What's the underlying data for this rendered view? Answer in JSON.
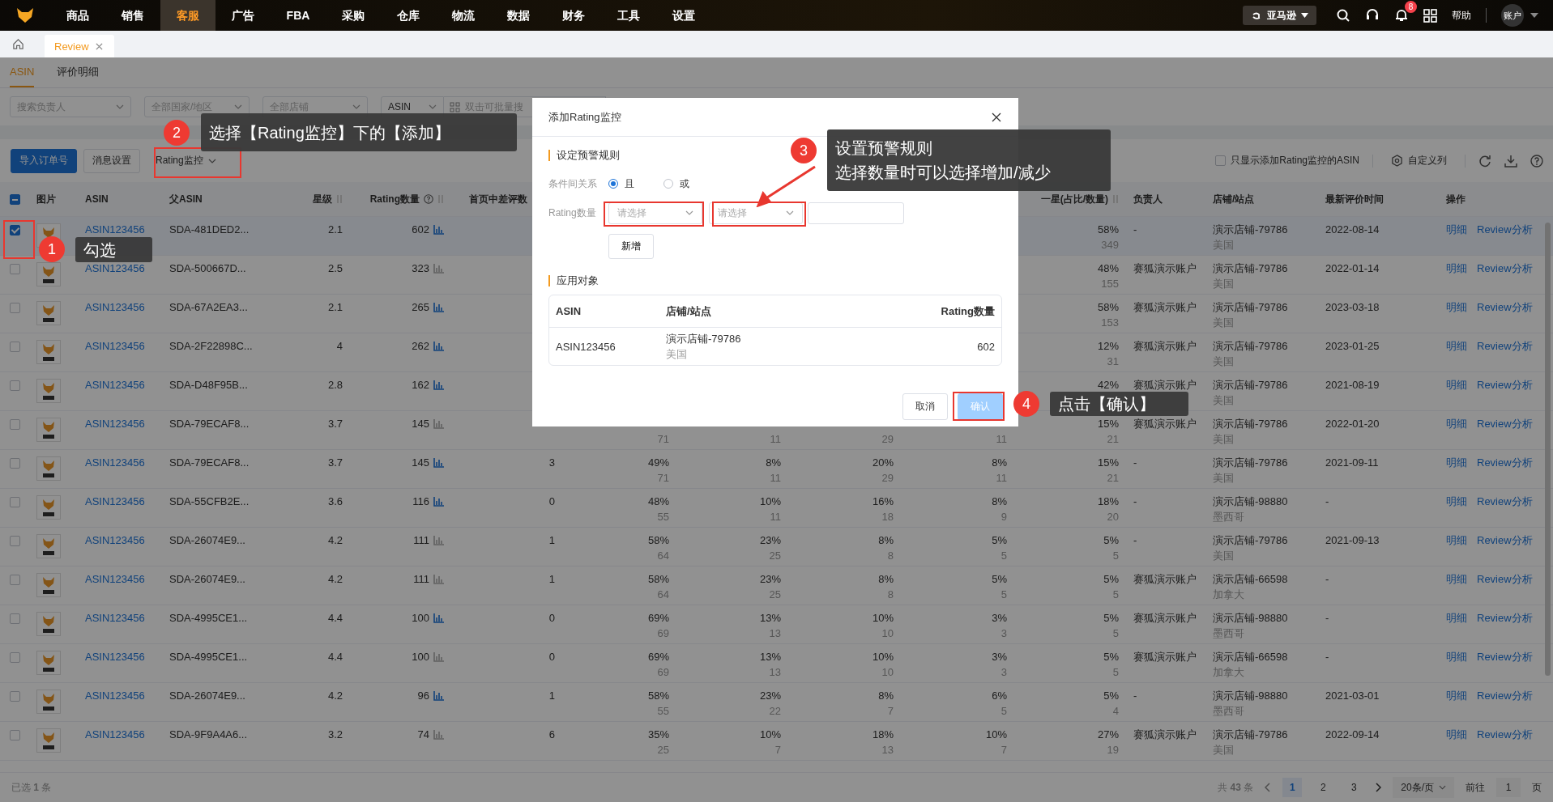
{
  "top_nav": {
    "items": [
      {
        "label": "商品",
        "selected": false
      },
      {
        "label": "销售",
        "selected": false
      },
      {
        "label": "客服",
        "selected": true
      },
      {
        "label": "广告",
        "selected": false
      },
      {
        "label": "FBA",
        "selected": false
      },
      {
        "label": "采购",
        "selected": false
      },
      {
        "label": "仓库",
        "selected": false
      },
      {
        "label": "物流",
        "selected": false
      },
      {
        "label": "数据",
        "selected": false
      },
      {
        "label": "财务",
        "selected": false
      },
      {
        "label": "工具",
        "selected": false
      },
      {
        "label": "设置",
        "selected": false
      }
    ],
    "marketplace": "亚马逊",
    "notification_count": "8",
    "help": "帮助",
    "account": "账户"
  },
  "page_tabs": [
    {
      "label": "Review",
      "selected": true
    }
  ],
  "sub_tabs": [
    {
      "label": "ASIN",
      "selected": true
    },
    {
      "label": "评价明细",
      "selected": false
    }
  ],
  "filters": [
    {
      "placeholder": "搜索负责人"
    },
    {
      "placeholder": "全部国家/地区"
    },
    {
      "placeholder": "全部店铺"
    }
  ],
  "search": {
    "field": "ASIN",
    "placeholder": "双击可批量搜"
  },
  "toolbar": {
    "buttons": [
      {
        "label": "导入订单号",
        "kind": "primary"
      },
      {
        "label": "消息设置",
        "kind": "plain"
      },
      {
        "label": "Rating监控",
        "kind": "dropdown"
      }
    ],
    "only_monitored": {
      "label": "只显示添加Rating监控的ASIN",
      "checked": false
    },
    "custom_columns": "自定义列"
  },
  "table": {
    "some_selected": true,
    "columns": [
      {
        "label": "图片",
        "sortable": false,
        "help": false
      },
      {
        "label": "ASIN",
        "sortable": false,
        "help": false
      },
      {
        "label": "父ASIN",
        "sortable": false,
        "help": false
      },
      {
        "label": "星级",
        "sortable": true,
        "help": false
      },
      {
        "label": "Rating数量",
        "sortable": true,
        "help": true
      },
      {
        "label": "首页中差评数",
        "sortable": false,
        "help": false
      },
      {
        "label": "一星(占比/数量)",
        "sortable": true,
        "help": false
      },
      {
        "label": "负责人",
        "sortable": false,
        "help": false
      },
      {
        "label": "店铺/站点",
        "sortable": false,
        "help": false
      },
      {
        "label": "最新评价时间",
        "sortable": false,
        "help": false
      },
      {
        "label": "操作",
        "sortable": false,
        "help": false
      }
    ],
    "rows": [
      {
        "selected": true,
        "asin": "ASIN123456",
        "parent_asin": "SDA-481DED2...",
        "rating": "2.1",
        "rating_count": "602",
        "trend_highlighted": true,
        "one_star": {
          "pct": "58%",
          "count": "349"
        },
        "owner": "-",
        "store": "演示店铺-79786",
        "site": "美国",
        "latest": "2022-08-14",
        "actions": [
          "明细",
          "Review分析"
        ]
      },
      {
        "selected": false,
        "asin": "ASIN123456",
        "parent_asin": "SDA-500667D...",
        "rating": "2.5",
        "rating_count": "323",
        "trend_highlighted": false,
        "one_star": {
          "pct": "48%",
          "count": "155"
        },
        "owner": "赛狐演示账户",
        "store": "演示店铺-79786",
        "site": "美国",
        "latest": "2022-01-14",
        "actions": [
          "明细",
          "Review分析"
        ]
      },
      {
        "selected": false,
        "asin": "ASIN123456",
        "parent_asin": "SDA-67A2EA3...",
        "rating": "2.1",
        "rating_count": "265",
        "trend_highlighted": true,
        "one_star": {
          "pct": "58%",
          "count": "153"
        },
        "owner": "赛狐演示账户",
        "store": "演示店铺-79786",
        "site": "美国",
        "latest": "2023-03-18",
        "actions": [
          "明细",
          "Review分析"
        ]
      },
      {
        "selected": false,
        "asin": "ASIN123456",
        "parent_asin": "SDA-2F22898C...",
        "rating": "4",
        "rating_count": "262",
        "trend_highlighted": true,
        "one_star": {
          "pct": "12%",
          "count": "31"
        },
        "owner": "赛狐演示账户",
        "store": "演示店铺-79786",
        "site": "美国",
        "latest": "2023-01-25",
        "actions": [
          "明细",
          "Review分析"
        ]
      },
      {
        "selected": false,
        "asin": "ASIN123456",
        "parent_asin": "SDA-D48F95B...",
        "rating": "2.8",
        "rating_count": "162",
        "trend_highlighted": true,
        "one_star": {
          "pct": "42%"
        },
        "owner": "赛狐演示账户",
        "store": "演示店铺-79786",
        "site": "美国",
        "latest": "2021-08-19",
        "actions": [
          "明细",
          "Review分析"
        ]
      },
      {
        "selected": false,
        "asin": "ASIN123456",
        "parent_asin": "SDA-79ECAF8...",
        "rating": "3.7",
        "rating_count": "145",
        "trend_highlighted": false,
        "dist": [
          {
            "count": "71"
          },
          {
            "count": "11"
          },
          {
            "count": "29"
          },
          {
            "count": "11"
          }
        ],
        "one_star": {
          "pct": "15%",
          "count": "21"
        },
        "owner": "赛狐演示账户",
        "store": "演示店铺-79786",
        "site": "美国",
        "latest": "2022-01-20",
        "actions": [
          "明细",
          "Review分析"
        ]
      },
      {
        "selected": false,
        "asin": "ASIN123456",
        "parent_asin": "SDA-79ECAF8...",
        "rating": "3.7",
        "rating_count": "145",
        "trend_highlighted": true,
        "first_page_negative": "3",
        "dist": [
          {
            "pct": "49%",
            "count": "71"
          },
          {
            "pct": "8%",
            "count": "11"
          },
          {
            "pct": "20%",
            "count": "29"
          },
          {
            "pct": "8%",
            "count": "11"
          }
        ],
        "one_star": {
          "pct": "15%",
          "count": "21"
        },
        "owner": "-",
        "store": "演示店铺-79786",
        "site": "美国",
        "latest": "2021-09-11",
        "actions": [
          "明细",
          "Review分析"
        ]
      },
      {
        "selected": false,
        "asin": "ASIN123456",
        "parent_asin": "SDA-55CFB2E...",
        "rating": "3.6",
        "rating_count": "116",
        "trend_highlighted": true,
        "first_page_negative": "0",
        "dist": [
          {
            "pct": "48%",
            "count": "55"
          },
          {
            "pct": "10%",
            "count": "11"
          },
          {
            "pct": "16%",
            "count": "18"
          },
          {
            "pct": "8%",
            "count": "9"
          }
        ],
        "one_star": {
          "pct": "18%",
          "count": "20"
        },
        "owner": "-",
        "store": "演示店铺-98880",
        "site": "墨西哥",
        "latest": "-",
        "actions": [
          "明细",
          "Review分析"
        ]
      },
      {
        "selected": false,
        "asin": "ASIN123456",
        "parent_asin": "SDA-26074E9...",
        "rating": "4.2",
        "rating_count": "111",
        "trend_highlighted": false,
        "first_page_negative": "1",
        "dist": [
          {
            "pct": "58%",
            "count": "64"
          },
          {
            "pct": "23%",
            "count": "25"
          },
          {
            "pct": "8%",
            "count": "8"
          },
          {
            "pct": "5%",
            "count": "5"
          }
        ],
        "one_star": {
          "pct": "5%",
          "count": "5"
        },
        "owner": "-",
        "store": "演示店铺-79786",
        "site": "美国",
        "latest": "2021-09-13",
        "actions": [
          "明细",
          "Review分析"
        ]
      },
      {
        "selected": false,
        "asin": "ASIN123456",
        "parent_asin": "SDA-26074E9...",
        "rating": "4.2",
        "rating_count": "111",
        "trend_highlighted": false,
        "first_page_negative": "1",
        "dist": [
          {
            "pct": "58%",
            "count": "64"
          },
          {
            "pct": "23%",
            "count": "25"
          },
          {
            "pct": "8%",
            "count": "8"
          },
          {
            "pct": "5%",
            "count": "5"
          }
        ],
        "one_star": {
          "pct": "5%",
          "count": "5"
        },
        "owner": "赛狐演示账户",
        "store": "演示店铺-66598",
        "site": "加拿大",
        "latest": "-",
        "actions": [
          "明细",
          "Review分析"
        ]
      },
      {
        "selected": false,
        "asin": "ASIN123456",
        "parent_asin": "SDA-4995CE1...",
        "rating": "4.4",
        "rating_count": "100",
        "trend_highlighted": true,
        "first_page_negative": "0",
        "dist": [
          {
            "pct": "69%",
            "count": "69"
          },
          {
            "pct": "13%",
            "count": "13"
          },
          {
            "pct": "10%",
            "count": "10"
          },
          {
            "pct": "3%",
            "count": "3"
          }
        ],
        "one_star": {
          "pct": "5%",
          "count": "5"
        },
        "owner": "赛狐演示账户",
        "store": "演示店铺-98880",
        "site": "墨西哥",
        "latest": "-",
        "actions": [
          "明细",
          "Review分析"
        ]
      },
      {
        "selected": false,
        "asin": "ASIN123456",
        "parent_asin": "SDA-4995CE1...",
        "rating": "4.4",
        "rating_count": "100",
        "trend_highlighted": false,
        "first_page_negative": "0",
        "dist": [
          {
            "pct": "69%",
            "count": "69"
          },
          {
            "pct": "13%",
            "count": "13"
          },
          {
            "pct": "10%",
            "count": "10"
          },
          {
            "pct": "3%",
            "count": "3"
          }
        ],
        "one_star": {
          "pct": "5%",
          "count": "5"
        },
        "owner": "赛狐演示账户",
        "store": "演示店铺-66598",
        "site": "加拿大",
        "latest": "-",
        "actions": [
          "明细",
          "Review分析"
        ]
      },
      {
        "selected": false,
        "asin": "ASIN123456",
        "parent_asin": "SDA-26074E9...",
        "rating": "4.2",
        "rating_count": "96",
        "trend_highlighted": true,
        "first_page_negative": "1",
        "dist": [
          {
            "pct": "58%",
            "count": "55"
          },
          {
            "pct": "23%",
            "count": "22"
          },
          {
            "pct": "8%",
            "count": "7"
          },
          {
            "pct": "6%",
            "count": "5"
          }
        ],
        "one_star": {
          "pct": "5%",
          "count": "4"
        },
        "owner": "-",
        "store": "演示店铺-98880",
        "site": "墨西哥",
        "latest": "2021-03-01",
        "actions": [
          "明细",
          "Review分析"
        ]
      },
      {
        "selected": false,
        "asin": "ASIN123456",
        "parent_asin": "SDA-9F9A4A6...",
        "rating": "3.2",
        "rating_count": "74",
        "trend_highlighted": false,
        "first_page_negative": "6",
        "dist": [
          {
            "pct": "35%",
            "count": "25"
          },
          {
            "pct": "10%",
            "count": "7"
          },
          {
            "pct": "18%",
            "count": "13"
          },
          {
            "pct": "10%",
            "count": "7"
          }
        ],
        "one_star": {
          "pct": "27%",
          "count": "19"
        },
        "owner": "赛狐演示账户",
        "store": "演示店铺-79786",
        "site": "美国",
        "latest": "2022-09-14",
        "actions": [
          "明细",
          "Review分析"
        ]
      }
    ]
  },
  "footer": {
    "selected_text": "已选 **1** 条",
    "total_text": "共 **43** 条",
    "pages": [
      {
        "label": "1",
        "selected": true
      },
      {
        "label": "2",
        "selected": false
      },
      {
        "label": "3",
        "selected": false
      }
    ],
    "page_size": "20条/页",
    "goto_label": "前往",
    "goto_value": "1",
    "page_suffix": "页"
  },
  "dialog": {
    "title": "添加Rating监控",
    "rule_section": "设定预警规则",
    "relation_label": "条件间关系",
    "relation_options": [
      {
        "label": "且",
        "selected": true
      },
      {
        "label": "或",
        "selected": false
      }
    ],
    "condition_label": "Rating数量",
    "selects": [
      {
        "placeholder": "请选择"
      },
      {
        "placeholder": "请选择"
      }
    ],
    "add_button": "新增",
    "target_section": "应用对象",
    "target_table": {
      "columns": [
        "ASIN",
        "店铺/站点",
        "Rating数量"
      ],
      "rows": [
        {
          "asin": "ASIN123456",
          "store": "演示店铺-79786",
          "site": "美国",
          "rating_count": "602"
        }
      ]
    },
    "buttons": [
      {
        "label": "取消",
        "kind": "cancel"
      },
      {
        "label": "确认",
        "kind": "confirm"
      }
    ]
  },
  "callouts": [
    {
      "number": "1",
      "lines": [
        "勾选"
      ]
    },
    {
      "number": "2",
      "lines": [
        "选择【Rating监控】下的【添加】"
      ]
    },
    {
      "number": "3",
      "lines": [
        "设置预警规则",
        "选择数量时可以选择增加/减少"
      ]
    },
    {
      "number": "4",
      "lines": [
        "点击【确认】"
      ]
    }
  ]
}
